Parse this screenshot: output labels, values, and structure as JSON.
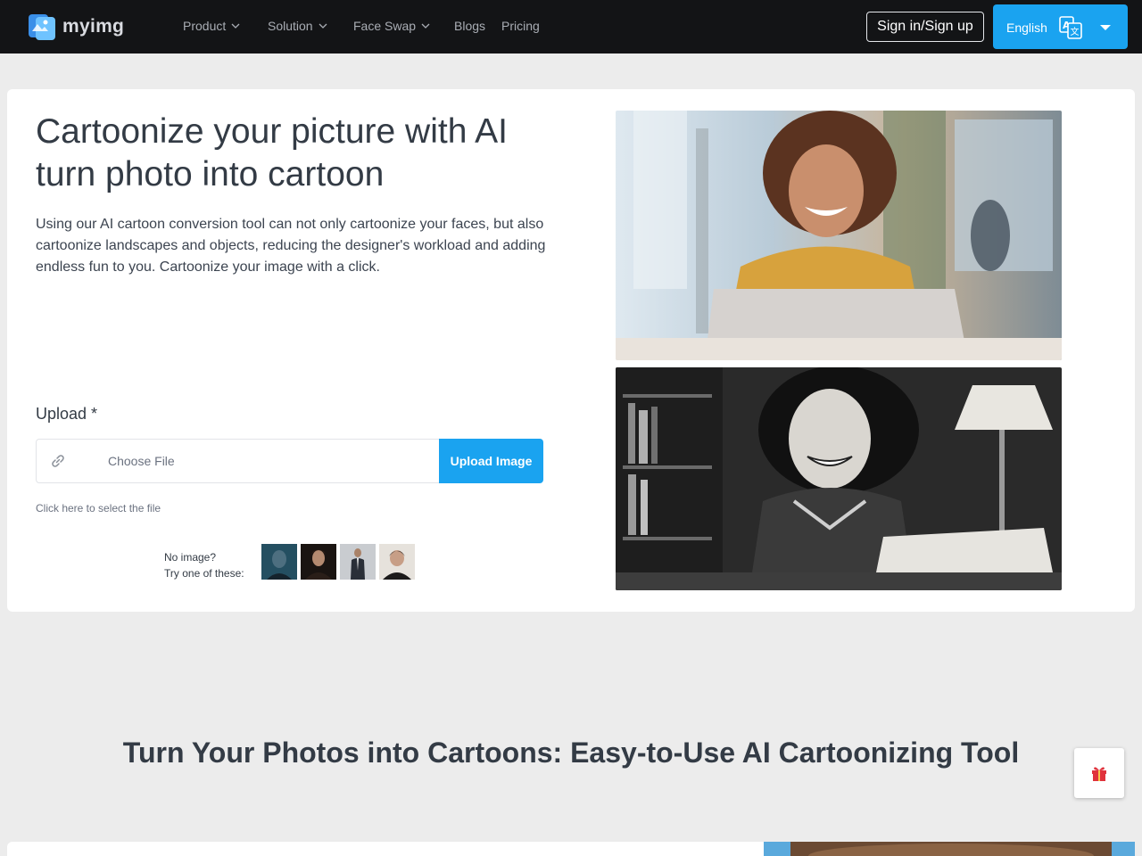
{
  "brand": {
    "name": "myimg"
  },
  "nav": {
    "items": [
      {
        "label": "Product",
        "dropdown": true
      },
      {
        "label": "Solution",
        "dropdown": true
      },
      {
        "label": "Face Swap",
        "dropdown": true
      },
      {
        "label": "Blogs",
        "dropdown": false
      },
      {
        "label": "Pricing",
        "dropdown": false
      }
    ],
    "signin_label": "Sign in/Sign up",
    "language": {
      "selected": "English",
      "icon": "translate-icon"
    }
  },
  "hero": {
    "title": "Cartoonize your picture with AI turn photo into cartoon",
    "description": "Using our AI cartoon conversion tool can not only cartoonize your faces, but also cartoonize landscapes and objects, reducing the designer's workload and adding endless fun to you. Cartoonize your image with a click.",
    "upload": {
      "label": "Upload *",
      "placeholder": "Choose File",
      "button_label": "Upload Image",
      "hint": "Click here to select the file"
    },
    "samples": {
      "line1": "No image?",
      "line2": "Try one of these:",
      "count": 4
    },
    "images": [
      {
        "icon": "before-photo-woman-laptop"
      },
      {
        "icon": "after-cartoon-woman-desk"
      }
    ]
  },
  "section": {
    "title": "Turn Your Photos into Cartoons: Easy-to-Use AI Cartoonizing Tool"
  },
  "colors": {
    "accent": "#1aa3f0",
    "navbar": "#131416",
    "page_bg": "#ececec",
    "text": "#333b45"
  },
  "floating": {
    "icon": "gift-icon"
  }
}
